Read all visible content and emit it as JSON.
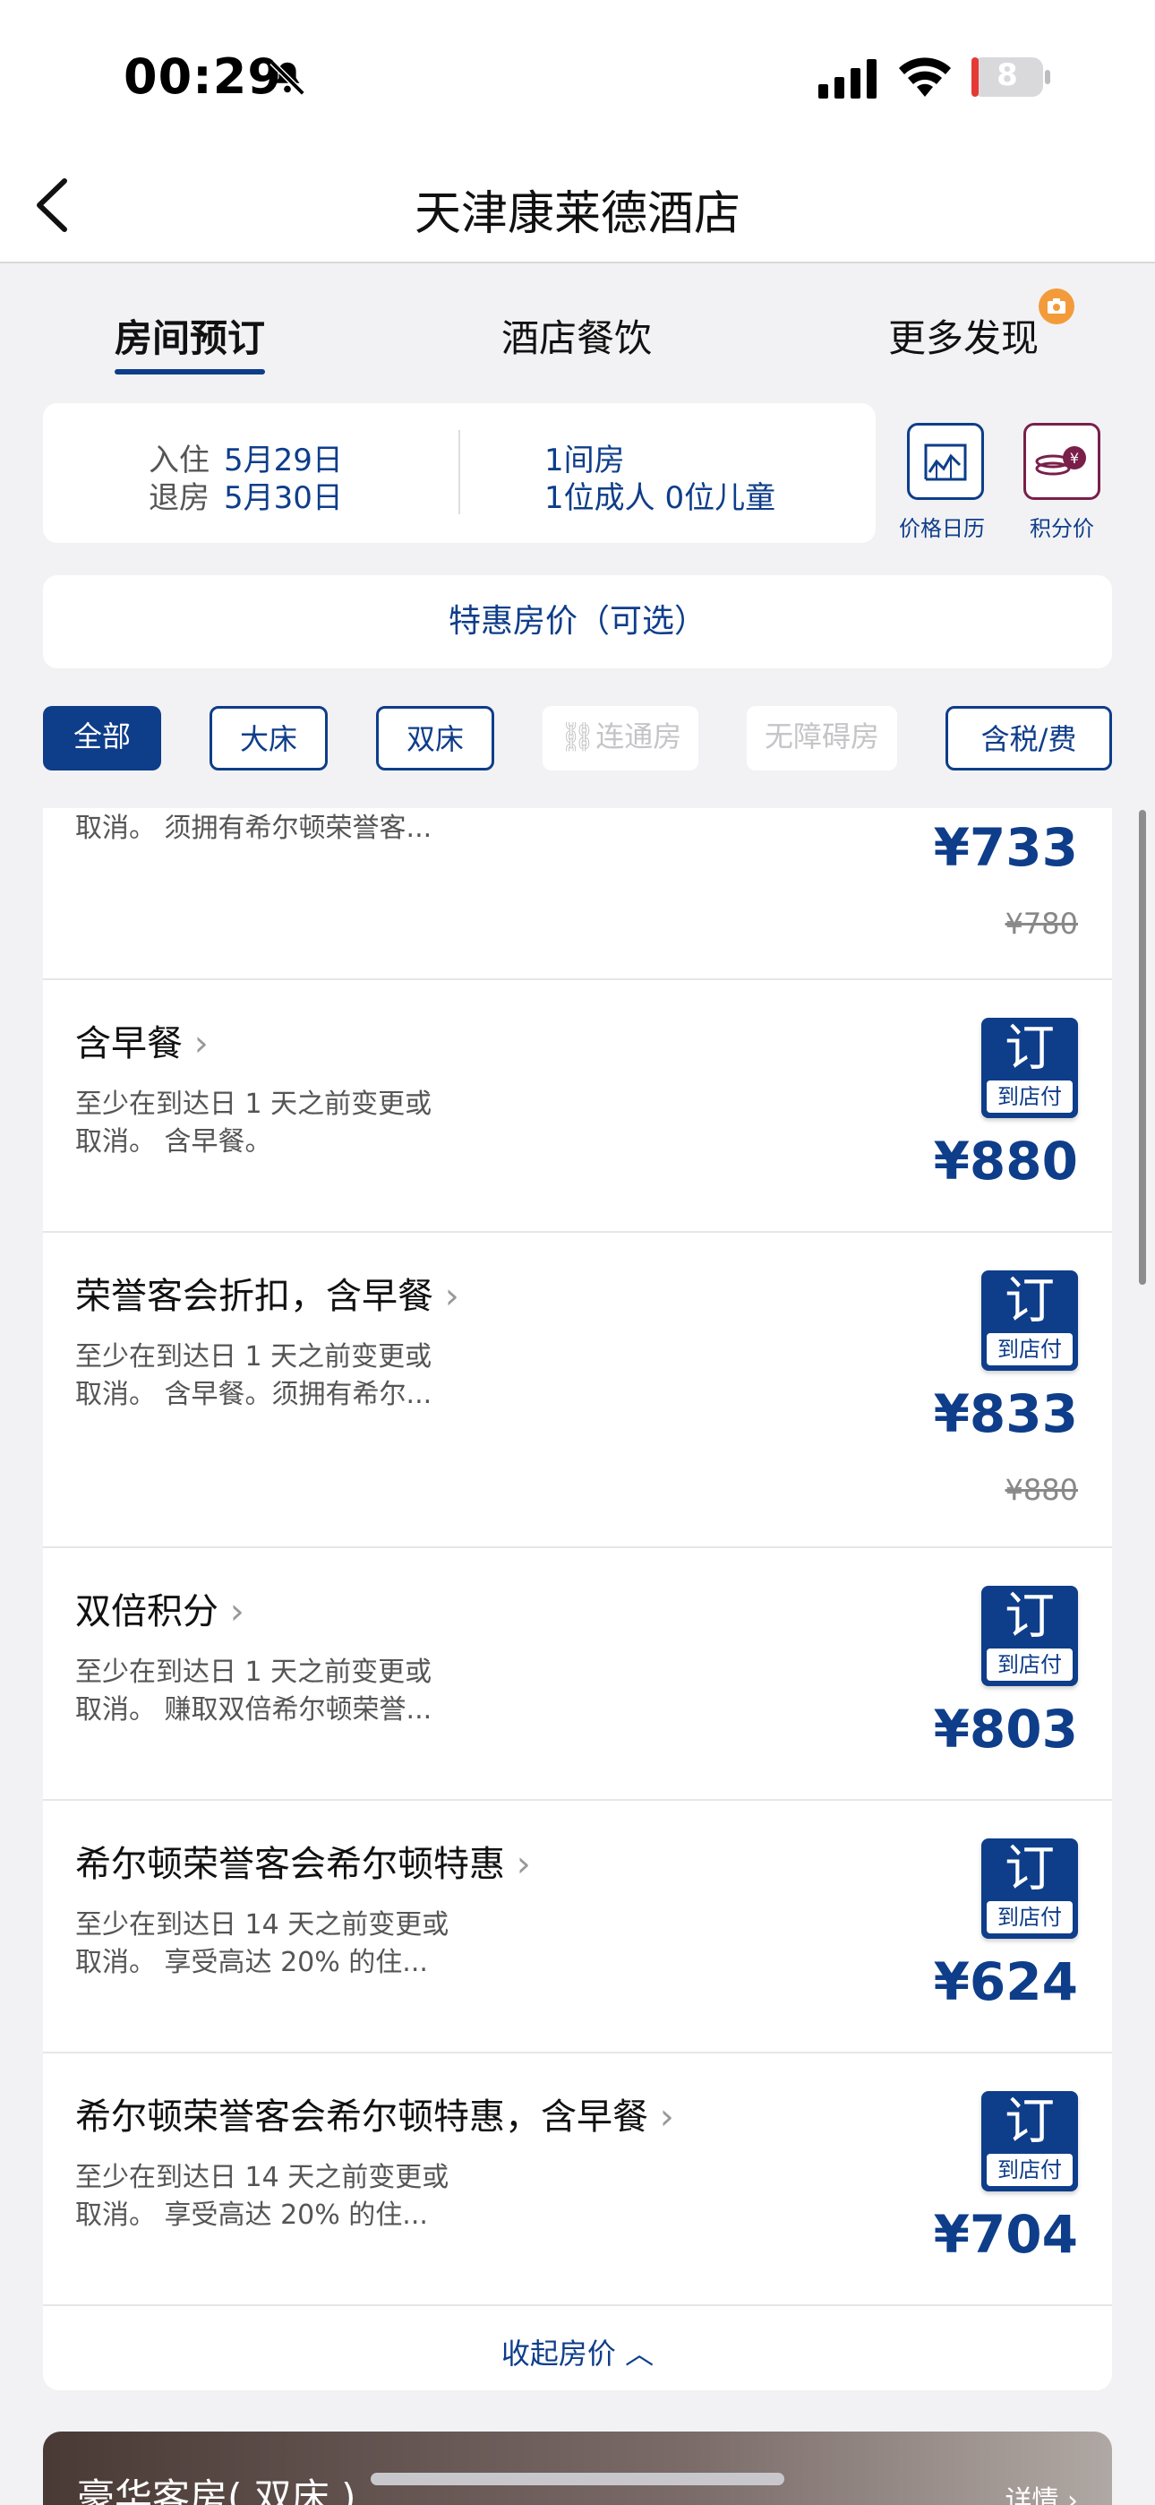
{
  "status_bar": {
    "time": "00:29",
    "battery_level": "8"
  },
  "header": {
    "title": "天津康莱德酒店"
  },
  "tabs": [
    {
      "label": "房间预订",
      "active": true
    },
    {
      "label": "酒店餐饮",
      "active": false
    },
    {
      "label": "更多发现",
      "active": false
    }
  ],
  "booking": {
    "checkin_label": "入住",
    "checkin_date": "5月29日",
    "checkout_label": "退房",
    "checkout_date": "5月30日",
    "rooms": "1间房",
    "guests": "1位成人 0位儿童"
  },
  "tools": {
    "calendar_label": "价格日历",
    "points_label": "积分价"
  },
  "promo": {
    "label": "特惠房价（可选）"
  },
  "filters": [
    {
      "label": "全部",
      "state": "selected"
    },
    {
      "label": "大床",
      "state": "normal"
    },
    {
      "label": "双床",
      "state": "normal"
    },
    {
      "label": "连通房",
      "state": "disabled"
    },
    {
      "label": "无障碍房",
      "state": "disabled"
    },
    {
      "label": "含税/费",
      "state": "normal"
    }
  ],
  "rates": [
    {
      "name": "",
      "desc_line1": "取消。 须拥有希尔顿荣誉客...",
      "desc_line2": "",
      "price": "¥733",
      "old_price": "¥780",
      "book": "",
      "book_sub": ""
    },
    {
      "name": "含早餐",
      "desc_line1": "至少在到达日 1 天之前变更或",
      "desc_line2": "取消。 含早餐。",
      "price": "¥880",
      "old_price": "",
      "book": "订",
      "book_sub": "到店付"
    },
    {
      "name": "荣誉客会折扣，含早餐",
      "desc_line1": "至少在到达日 1 天之前变更或",
      "desc_line2": "取消。 含早餐。须拥有希尔...",
      "price": "¥833",
      "old_price": "¥880",
      "book": "订",
      "book_sub": "到店付"
    },
    {
      "name": "双倍积分",
      "desc_line1": "至少在到达日 1 天之前变更或",
      "desc_line2": "取消。 赚取双倍希尔顿荣誉...",
      "price": "¥803",
      "old_price": "",
      "book": "订",
      "book_sub": "到店付"
    },
    {
      "name": "希尔顿荣誉客会希尔顿特惠",
      "desc_line1": "至少在到达日 14 天之前变更或",
      "desc_line2": "取消。 享受高达 20% 的住...",
      "price": "¥624",
      "old_price": "",
      "book": "订",
      "book_sub": "到店付"
    },
    {
      "name": "希尔顿荣誉客会希尔顿特惠，含早餐",
      "desc_line1": "至少在到达日 14 天之前变更或",
      "desc_line2": "取消。 享受高达 20% 的住...",
      "price": "¥704",
      "old_price": "",
      "book": "订",
      "book_sub": "到店付"
    }
  ],
  "collapse": {
    "label": "收起房价"
  },
  "room_card": {
    "title": "豪华客房( 双床 )",
    "details": "详情"
  },
  "colors": {
    "brand": "#0e3d8a",
    "accent": "#f39b3b",
    "points": "#7a1f4a"
  }
}
